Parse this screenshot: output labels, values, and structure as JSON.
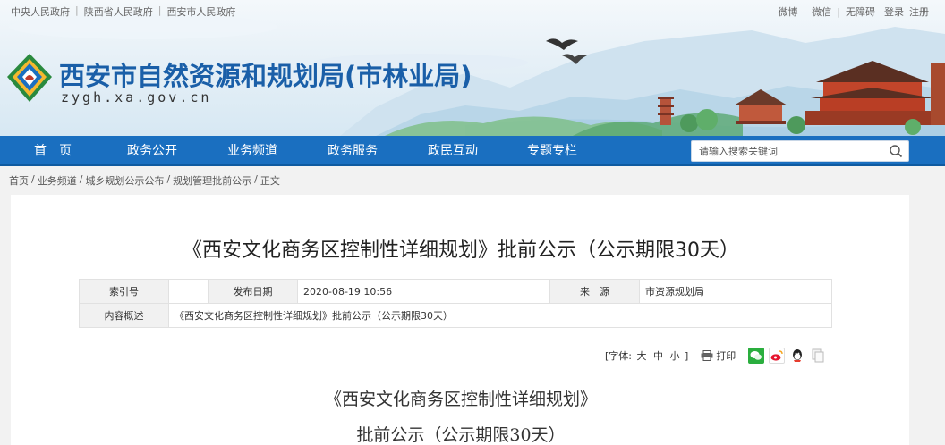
{
  "top_links_left": [
    "中央人民政府",
    "陕西省人民政府",
    "西安市人民政府"
  ],
  "top_links_right": [
    "微博",
    "微信",
    "无障碍",
    "登录",
    "注册"
  ],
  "site": {
    "title": "西安市自然资源和规划局(市林业局)",
    "domain": "zygh.xa.gov.cn"
  },
  "nav": {
    "items": [
      "首　页",
      "政务公开",
      "业务频道",
      "政务服务",
      "政民互动",
      "专题专栏"
    ],
    "search_placeholder": "请输入搜索关键词"
  },
  "breadcrumb": [
    "首页",
    "业务频道",
    "城乡规划公示公布",
    "规划管理批前公示",
    "正文"
  ],
  "article": {
    "title": "《西安文化商务区控制性详细规划》批前公示（公示期限30天）",
    "meta": {
      "index_label": "索引号",
      "index_value": "",
      "date_label": "发布日期",
      "date_value": "2020-08-19 10:56",
      "source_label": "来　源",
      "source_value": "市资源规划局",
      "summary_label": "内容概述",
      "summary_value": "《西安文化商务区控制性详细规划》批前公示（公示期限30天）"
    },
    "tools": {
      "font_label_open": "[字体:",
      "font_sizes": [
        "大",
        "中",
        "小"
      ],
      "font_label_close": "]",
      "print_label": "打印"
    },
    "share_icons": [
      "wechat-icon",
      "weibo-icon",
      "qq-icon",
      "copy-icon"
    ],
    "body_line1": "《西安文化商务区控制性详细规划》",
    "body_line2": "批前公示（公示期限30天）"
  },
  "colors": {
    "nav_bg": "#1a6fc0",
    "title_blue": "#1a5fa8",
    "wechat": "#2aae3e",
    "weibo": "#e6162d",
    "qq": "#1296db"
  }
}
